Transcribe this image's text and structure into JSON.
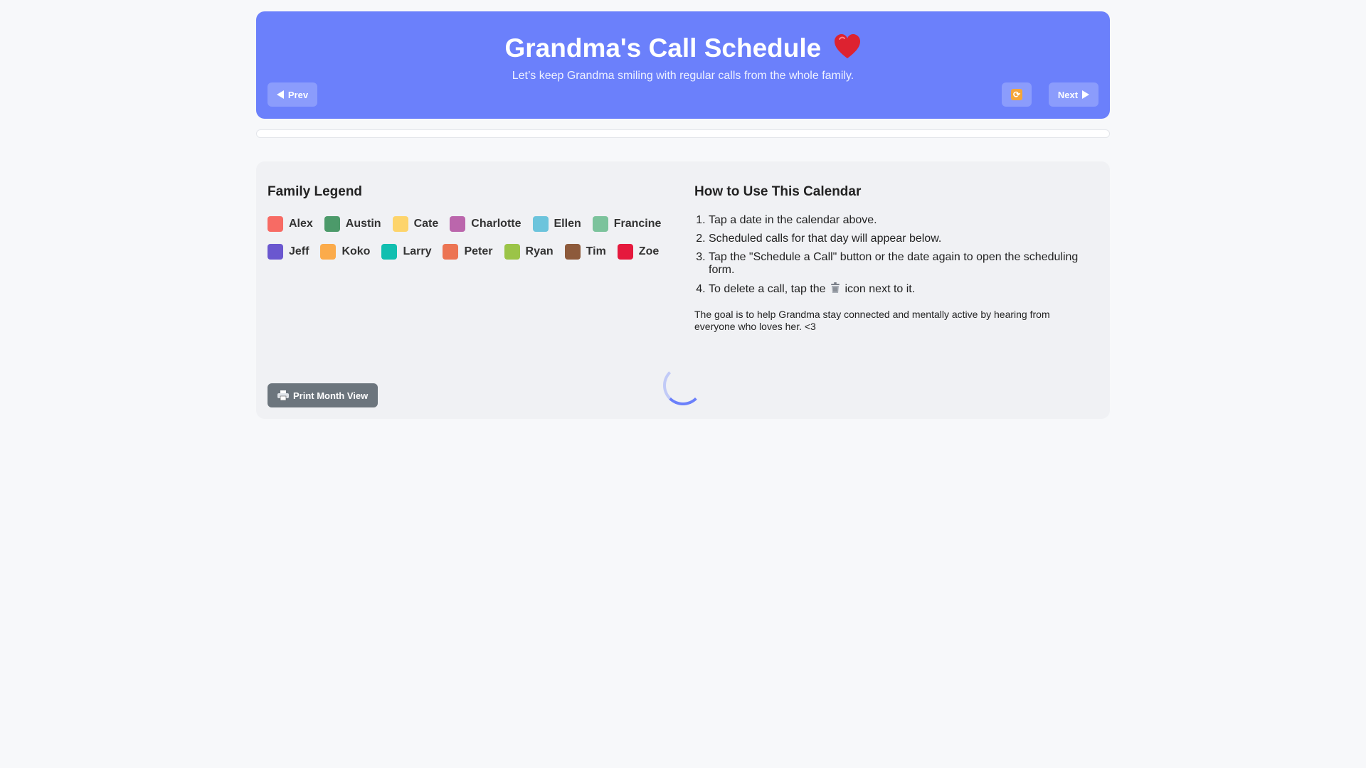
{
  "header": {
    "title": "Grandma's Call Schedule",
    "subtitle": "Let’s keep Grandma smiling with regular calls from the whole family.",
    "prev_label": "Prev",
    "next_label": "Next",
    "title_icon": "heart-icon",
    "refresh_icon": "refresh-icon",
    "accent_color": "#6b80fb"
  },
  "progress": {
    "fraction": 0
  },
  "legend": {
    "title": "Family Legend",
    "members": [
      {
        "name": "Alex",
        "color": "#f76b64"
      },
      {
        "name": "Austin",
        "color": "#4c9a6a"
      },
      {
        "name": "Cate",
        "color": "#fdd46b"
      },
      {
        "name": "Charlotte",
        "color": "#bb66ac"
      },
      {
        "name": "Ellen",
        "color": "#6cc4dc"
      },
      {
        "name": "Francine",
        "color": "#7cc39c"
      },
      {
        "name": "Jeff",
        "color": "#6a57cf"
      },
      {
        "name": "Koko",
        "color": "#fbab4b"
      },
      {
        "name": "Larry",
        "color": "#12bfb0"
      },
      {
        "name": "Peter",
        "color": "#ec7453"
      },
      {
        "name": "Ryan",
        "color": "#9bc448"
      },
      {
        "name": "Tim",
        "color": "#8d5a3b"
      },
      {
        "name": "Zoe",
        "color": "#e5193d"
      }
    ]
  },
  "howto": {
    "title": "How to Use This Calendar",
    "steps": [
      "Tap a date in the calendar above.",
      "Scheduled calls for that day will appear below.",
      "Tap the \"Schedule a Call\" button or the date again to open the scheduling form."
    ],
    "step4_prefix": "To delete a call, tap the",
    "step4_suffix": "icon next to it.",
    "step4_icon": "trash-icon",
    "goal": "The goal is to help Grandma stay connected and mentally active by hearing from everyone who loves her. <3"
  },
  "print": {
    "label": "Print Month View",
    "icon": "printer-icon"
  }
}
